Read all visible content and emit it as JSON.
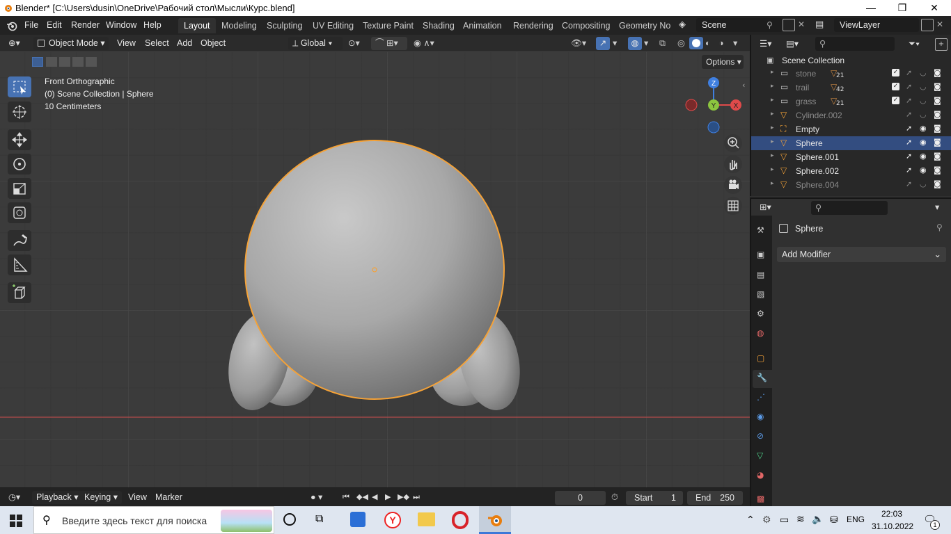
{
  "window": {
    "title": "Blender* [C:\\Users\\dusin\\OneDrive\\Рабочий стол\\Мысли\\Курс.blend]",
    "minimize": "—",
    "maximize": "❐",
    "close": "✕"
  },
  "menubar": {
    "menus": [
      "File",
      "Edit",
      "Render",
      "Window",
      "Help"
    ],
    "workspaces": [
      "Layout",
      "Modeling",
      "Sculpting",
      "UV Editing",
      "Texture Paint",
      "Shading",
      "Animation",
      "Rendering",
      "Compositing",
      "Geometry Noc"
    ],
    "active_workspace": "Layout",
    "scene": "Scene",
    "view_layer": "ViewLayer"
  },
  "viewport_header": {
    "mode": "Object Mode",
    "menus": [
      "View",
      "Select",
      "Add",
      "Object"
    ],
    "transform_orientation": "Global",
    "options_label": "Options"
  },
  "viewport": {
    "view_name": "Front Orthographic",
    "collection_info": "(0) Scene Collection | Sphere",
    "scale_info": "10 Centimeters",
    "gizmo_labels": {
      "z": "Z",
      "y": "Y",
      "x": "X"
    }
  },
  "timeline": {
    "menus": [
      "Playback",
      "Keying",
      "View",
      "Marker"
    ],
    "current_frame": "0",
    "start_label": "Start",
    "start_value": "1",
    "end_label": "End",
    "end_value": "250"
  },
  "outliner": {
    "root": "Scene Collection",
    "items": [
      {
        "name": "stone",
        "badge": "21",
        "dim": true,
        "type": "collection"
      },
      {
        "name": "trail",
        "badge": "42",
        "dim": true,
        "type": "collection"
      },
      {
        "name": "grass",
        "badge": "21",
        "dim": true,
        "type": "collection"
      },
      {
        "name": "Cylinder.002",
        "badge": "",
        "dim": true,
        "type": "mesh"
      },
      {
        "name": "Empty",
        "badge": "",
        "dim": false,
        "type": "empty"
      },
      {
        "name": "Sphere",
        "badge": "",
        "dim": false,
        "type": "mesh",
        "selected": true
      },
      {
        "name": "Sphere.001",
        "badge": "",
        "dim": false,
        "type": "mesh"
      },
      {
        "name": "Sphere.002",
        "badge": "",
        "dim": false,
        "type": "mesh"
      },
      {
        "name": "Sphere.004",
        "badge": "",
        "dim": true,
        "type": "mesh"
      }
    ]
  },
  "properties": {
    "object_name": "Sphere",
    "add_modifier": "Add Modifier"
  },
  "taskbar": {
    "search_placeholder": "Введите здесь текст для поиска",
    "language": "ENG",
    "time": "22:03",
    "date": "31.10.2022",
    "notifications": "1"
  },
  "colors": {
    "accent_blue": "#4772b3",
    "selection_orange": "#f5a237",
    "axis_x": "#e04a4a",
    "axis_y": "#8cc53f",
    "axis_z": "#3f7fe0"
  }
}
